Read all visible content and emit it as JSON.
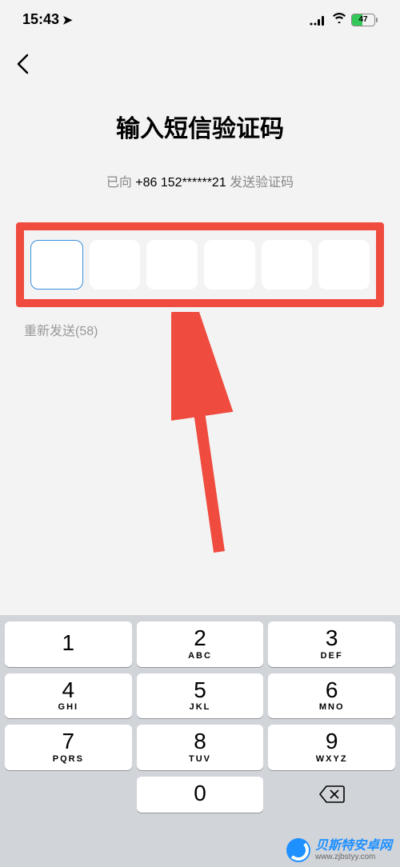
{
  "status": {
    "time": "15:43",
    "battery_pct": "47"
  },
  "nav": {
    "back_aria": "返回"
  },
  "page": {
    "title": "输入短信验证码",
    "sent_prefix": "已向 ",
    "phone": "+86 152******21",
    "sent_suffix": " 发送验证码",
    "resend_label": "重新发送(58)"
  },
  "code_boxes": [
    {
      "active": true
    },
    {
      "active": false
    },
    {
      "active": false
    },
    {
      "active": false
    },
    {
      "active": false
    },
    {
      "active": false
    }
  ],
  "keypad": {
    "rows": [
      [
        {
          "num": "1",
          "sub": ""
        },
        {
          "num": "2",
          "sub": "ABC"
        },
        {
          "num": "3",
          "sub": "DEF"
        }
      ],
      [
        {
          "num": "4",
          "sub": "GHI"
        },
        {
          "num": "5",
          "sub": "JKL"
        },
        {
          "num": "6",
          "sub": "MNO"
        }
      ],
      [
        {
          "num": "7",
          "sub": "PQRS"
        },
        {
          "num": "8",
          "sub": "TUV"
        },
        {
          "num": "9",
          "sub": "WXYZ"
        }
      ]
    ],
    "zero": {
      "num": "0",
      "sub": ""
    }
  },
  "watermark": {
    "main": "贝斯特安卓网",
    "sub": "www.zjbstyy.com"
  },
  "colors": {
    "highlight_border": "#ef4b3f",
    "active_box_border": "#3a8fdd",
    "battery_green": "#34c759"
  }
}
